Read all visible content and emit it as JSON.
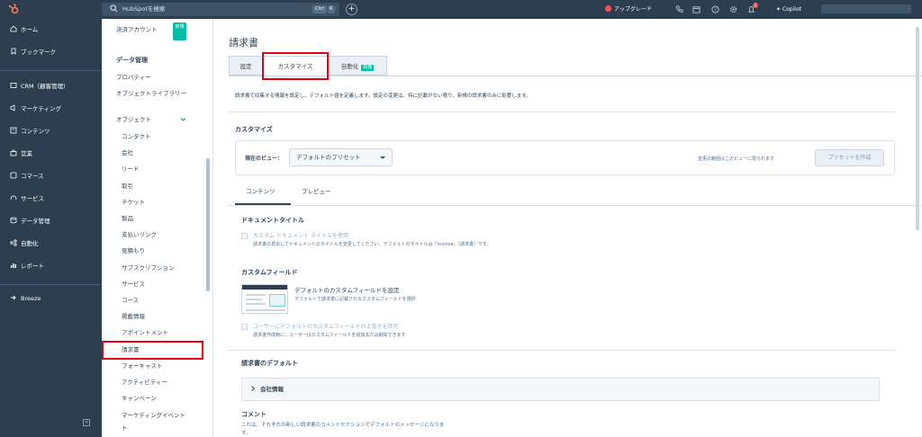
{
  "topbar": {
    "search_placeholder": "HubSpotを検索",
    "shortcut_ctrl": "Ctrl",
    "shortcut_k": "K",
    "upgrade": "アップグレード",
    "notification_count": "1",
    "copilot": "Copilot"
  },
  "nav": {
    "items": [
      {
        "label": "ホーム",
        "icon": "home-icon"
      },
      {
        "label": "ブックマーク",
        "icon": "bookmark-icon"
      },
      {
        "label": "CRM（顧客管理）",
        "icon": "crm-icon"
      },
      {
        "label": "マーケティング",
        "icon": "marketing-icon"
      },
      {
        "label": "コンテンツ",
        "icon": "content-icon"
      },
      {
        "label": "営業",
        "icon": "sales-icon"
      },
      {
        "label": "コマース",
        "icon": "commerce-icon"
      },
      {
        "label": "サービス",
        "icon": "service-icon"
      },
      {
        "label": "データ管理",
        "icon": "data-icon"
      },
      {
        "label": "自動化",
        "icon": "automation-icon"
      },
      {
        "label": "レポート",
        "icon": "report-icon"
      },
      {
        "label": "Breeze",
        "icon": "breeze-icon"
      }
    ]
  },
  "subnav": {
    "billing_account": "決済アカウント",
    "new_badge": "新規",
    "data_mgmt": "データ管理",
    "properties": "プロパティー",
    "object_library": "オブジェクトライブラリー",
    "objects": "オブジェクト",
    "object_items": [
      "コンタクト",
      "会社",
      "リード",
      "取引",
      "チケット",
      "製品",
      "支払いリンク",
      "見積もり",
      "サブスクリプション",
      "サービス",
      "コース",
      "掲載情報",
      "アポイントメント",
      "請求書",
      "フォーキャスト",
      "アクティビティー",
      "キャンペーン",
      "マーケティングイベント",
      "ト"
    ]
  },
  "page": {
    "title": "請求書",
    "tabs": [
      "設定",
      "カスタマイズ",
      "自動化"
    ],
    "tab_new_badge": "新機",
    "description": "請求書で収集する情報を設定し、デフォルト値を定義します。設定の変更は、特に記載がない限り、新規の請求書のみに影響します。",
    "customize_title": "カスタマイズ",
    "view_label": "現在のビュー：",
    "view_select": "デフォルトのプリセット",
    "view_note": "変更の範囲はこのビューに限られます",
    "create_preset": "プリセットを作成",
    "subtabs": [
      "コンテンツ",
      "プレビュー"
    ],
    "doc_title_heading": "ドキュメントタイトル",
    "doc_title_check": "カスタム ドキュメント タイトルを使用",
    "doc_title_desc": "請求書の見出しでドキュメントのタイトルを変更してください。デフォルトのタイトルは「Invoice」（請求書）です。",
    "custom_fields_heading": "カスタムフィールド",
    "cf_title": "デフォルトのカスタムフィールドを設定",
    "cf_desc": "デフォルトで請求書に記載されるカスタムフィールドを選択",
    "override_check": "ユーザーにデフォルトのカスタムフィールドの上書きを許可",
    "override_desc": "請求書作成時に、ユーザーはカスタムフィールドを追加または削除できます",
    "defaults_heading": "請求書のデフォルト",
    "company_info": "会社情報",
    "comment_heading": "コメント",
    "comment_desc": "これは、それぞれの新しい請求書のコメントセクションでデフォルトのメッセージになりま",
    "comment_desc2": "す。"
  },
  "colors": {
    "nav_bg": "#2d3e50",
    "accent_teal": "#00bda5",
    "highlight_red": "#e60012"
  }
}
